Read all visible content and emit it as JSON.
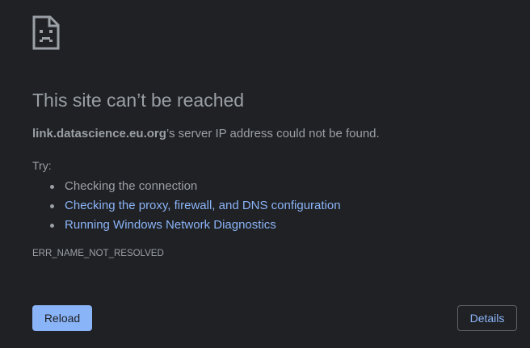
{
  "error": {
    "title": "This site can’t be reached",
    "host": "link.datascience.eu.org",
    "message_suffix": "’s server IP address could not be found.",
    "try_label": "Try:",
    "suggestions": [
      {
        "label": "Checking the connection",
        "link": false
      },
      {
        "label": "Checking the proxy, firewall, and DNS configuration",
        "link": true
      },
      {
        "label": "Running Windows Network Diagnostics",
        "link": true
      }
    ],
    "code": "ERR_NAME_NOT_RESOLVED"
  },
  "buttons": {
    "reload_label": "Reload",
    "details_label": "Details"
  },
  "icons": {
    "main": "sad-page-icon"
  },
  "colors": {
    "background": "#202124",
    "text": "#9aa0a6",
    "link": "#8ab4f8",
    "primary_button": "#8ab4f8",
    "border": "#5f6368"
  }
}
